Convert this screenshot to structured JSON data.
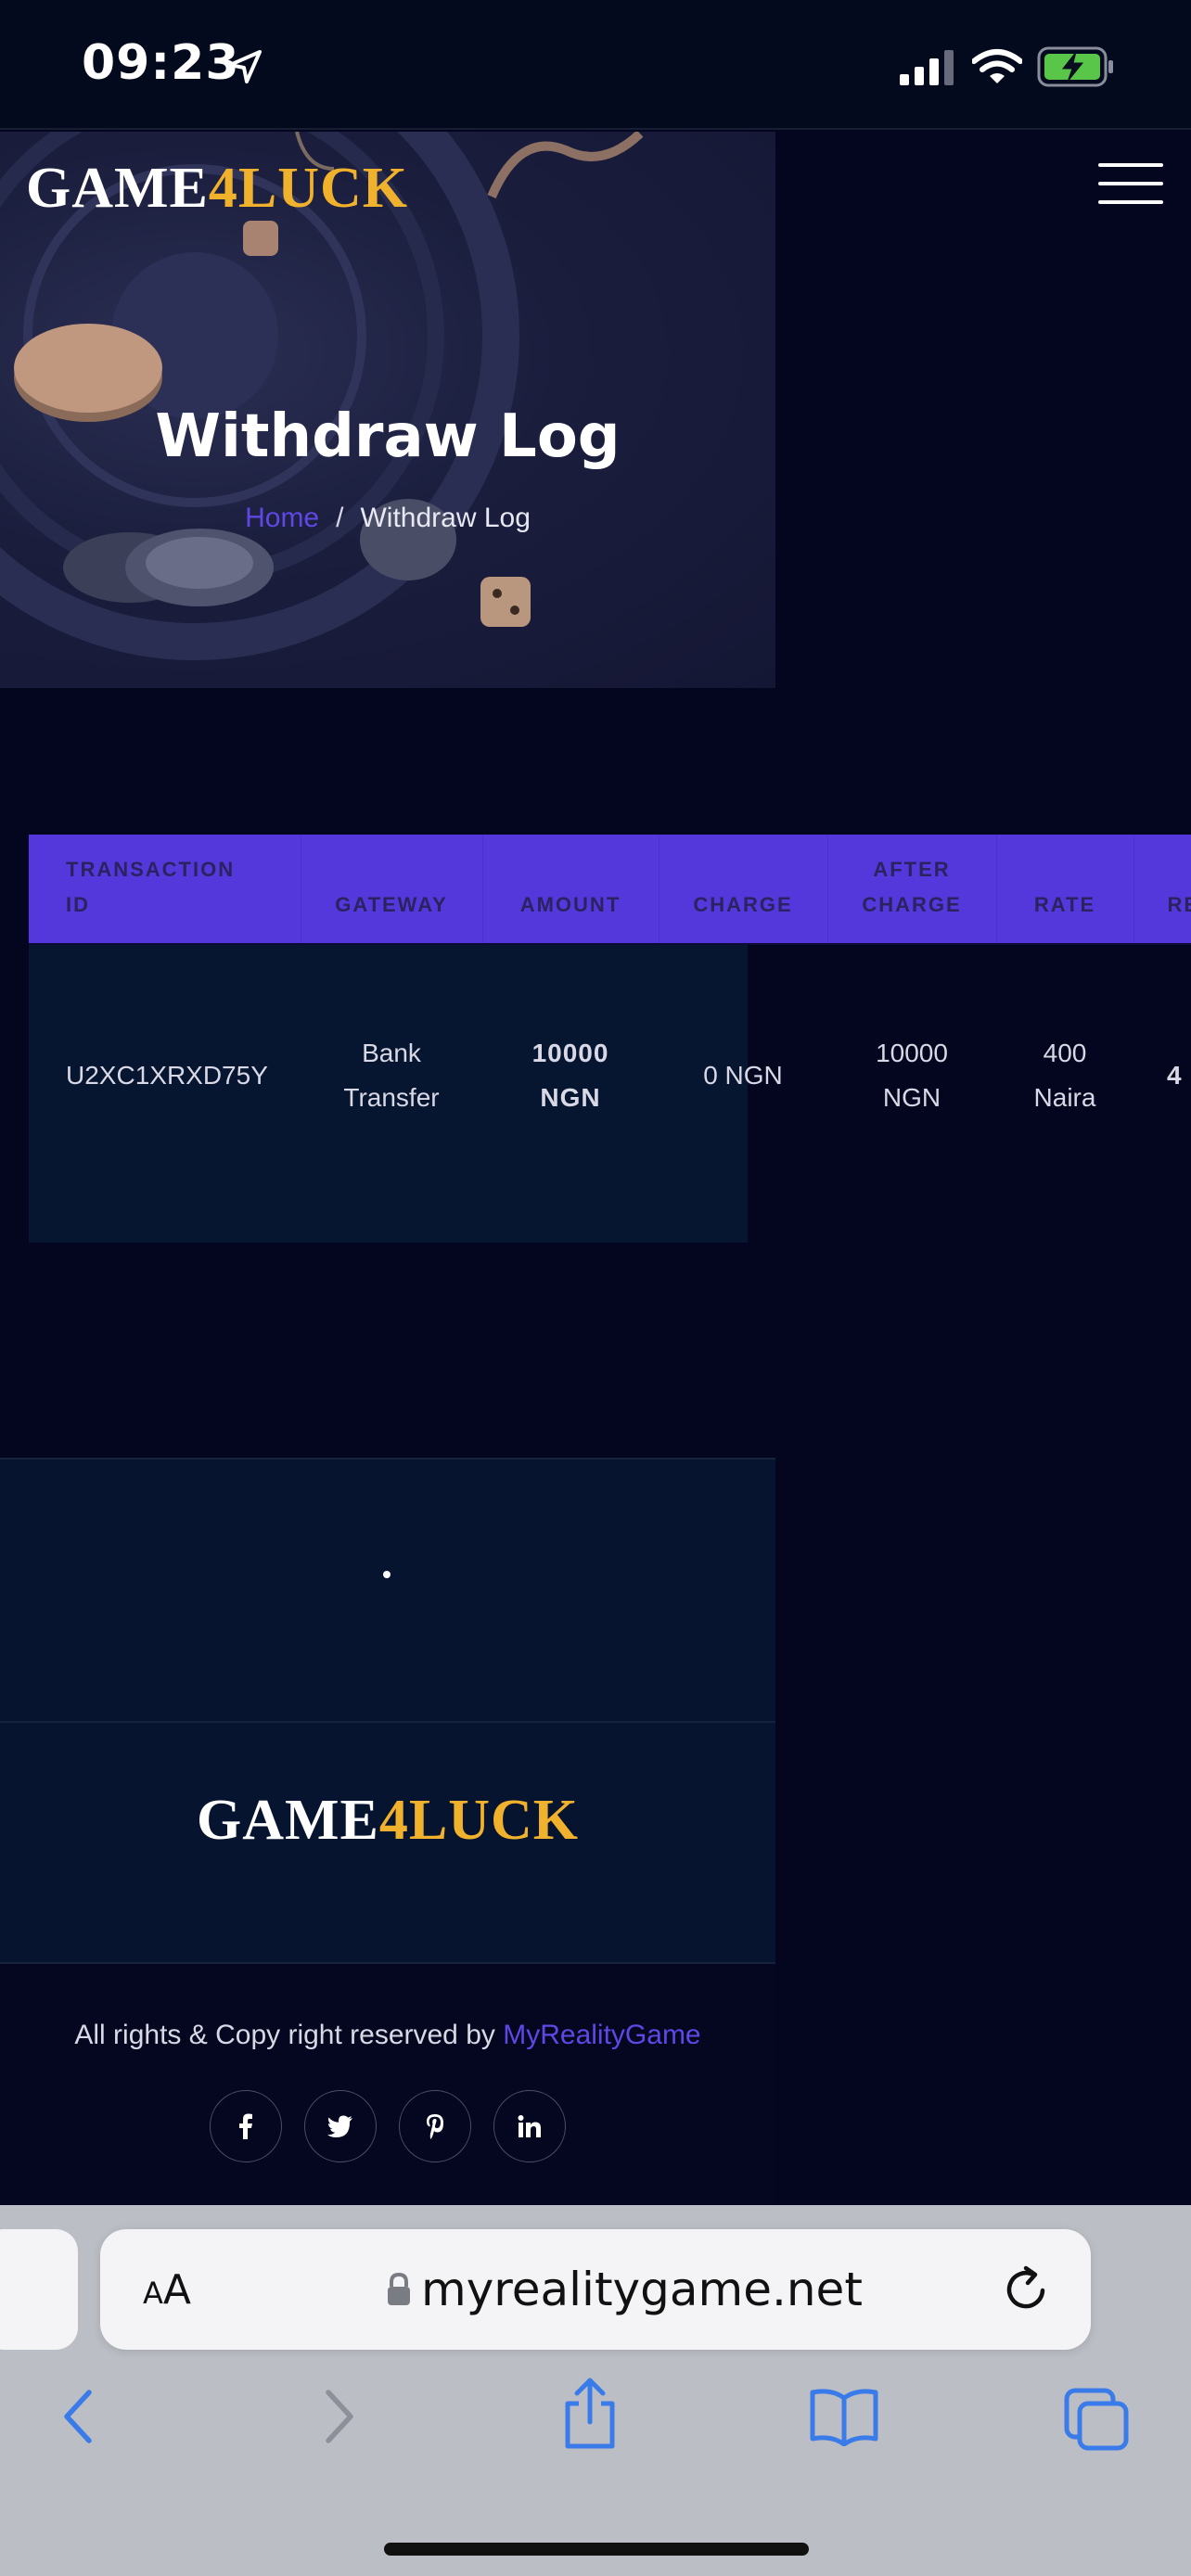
{
  "status_bar": {
    "time": "09:23"
  },
  "header": {
    "logo": {
      "part1": "GAME",
      "part2": "4",
      "part3": "L",
      "part4": "UCK"
    },
    "title": "Withdraw Log",
    "breadcrumb": {
      "home": "Home",
      "separator": "/",
      "current": "Withdraw Log"
    }
  },
  "table": {
    "headers": {
      "transaction_id": [
        "TRANSACTION",
        "ID"
      ],
      "gateway": "GATEWAY",
      "amount": "AMOUNT",
      "charge": "CHARGE",
      "after_charge": [
        "AFTER",
        "CHARGE"
      ],
      "rate": "RATE",
      "receivable": "RE"
    },
    "row": {
      "transaction_id": "U2XC1XRXD75Y",
      "gateway": [
        "Bank",
        "Transfer"
      ],
      "amount": [
        "10000",
        "NGN"
      ],
      "charge": "0 NGN",
      "after_charge": [
        "10000",
        "NGN"
      ],
      "rate": [
        "400",
        "Naira"
      ],
      "receivable": "4"
    }
  },
  "footer": {
    "logo": {
      "part1": "GAME",
      "part2": "4",
      "part3": "L",
      "part4": "UCK"
    },
    "copyright_prefix": "All rights & Copy right reserved by ",
    "copyright_brand": "MyRealityGame",
    "socials": [
      {
        "label": "f",
        "icon": "facebook-icon"
      },
      {
        "label": "twitter",
        "icon": "twitter-icon"
      },
      {
        "label": "p",
        "icon": "pinterest-icon"
      },
      {
        "label": "in",
        "icon": "linkedin-icon"
      }
    ]
  },
  "safari": {
    "aa_small": "A",
    "aa_large": "A",
    "url": "myrealitygame.net"
  },
  "colors": {
    "accent": "#5538dc",
    "logo_gold": "#f0b12c",
    "charge_red": "#e04a4a",
    "receivable_green": "#4cc469",
    "page_bg": "#04061f"
  }
}
